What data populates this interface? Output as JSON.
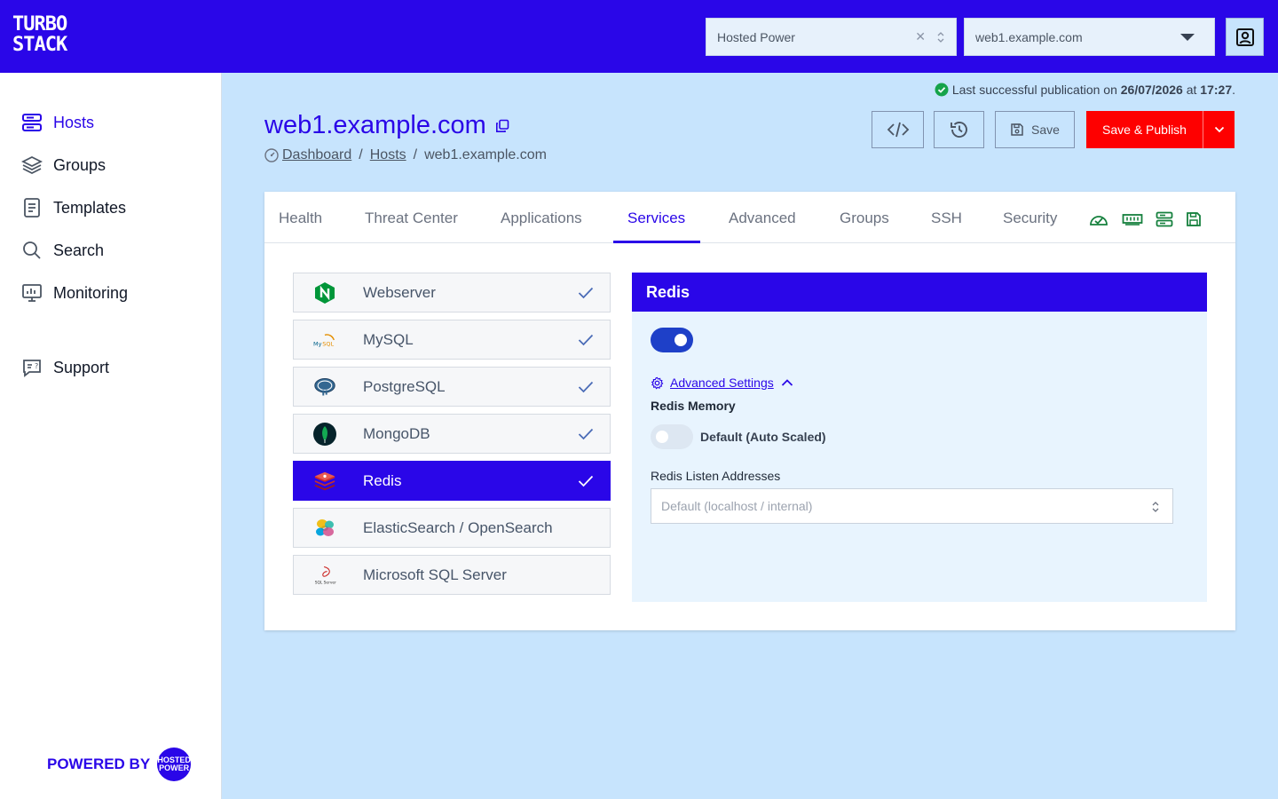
{
  "topbar": {
    "logo_line1": "TURBO",
    "logo_line2": "STACK",
    "owner_select": {
      "value": "Hosted Power"
    },
    "host_select": {
      "value": "web1.example.com"
    }
  },
  "sidebar": {
    "items": [
      {
        "label": "Hosts",
        "icon": "server-icon",
        "active": true
      },
      {
        "label": "Groups",
        "icon": "layers-icon",
        "active": false
      },
      {
        "label": "Templates",
        "icon": "document-icon",
        "active": false
      },
      {
        "label": "Search",
        "icon": "search-icon",
        "active": false
      },
      {
        "label": "Monitoring",
        "icon": "monitor-icon",
        "active": false
      }
    ],
    "support_label": "Support",
    "powered_by": "POWERED BY",
    "powered_badge_1": "HOSTED",
    "powered_badge_2": "POWER"
  },
  "header": {
    "status_prefix": "Last successful publication on ",
    "status_date": "26/07/2026",
    "status_mid": " at ",
    "status_time": "17:27",
    "status_suffix": ".",
    "title": "web1.example.com",
    "breadcrumb": [
      "Dashboard",
      "Hosts",
      "web1.example.com"
    ],
    "save_label": "Save",
    "publish_label": "Save & Publish"
  },
  "tabs": [
    "Health",
    "Threat Center",
    "Applications",
    "Services",
    "Advanced",
    "Groups",
    "SSH",
    "Security"
  ],
  "active_tab": "Services",
  "services": [
    {
      "label": "Webserver",
      "icon": "nginx-icon",
      "enabled": true
    },
    {
      "label": "MySQL",
      "icon": "mysql-icon",
      "enabled": true
    },
    {
      "label": "PostgreSQL",
      "icon": "postgresql-icon",
      "enabled": true
    },
    {
      "label": "MongoDB",
      "icon": "mongodb-icon",
      "enabled": true
    },
    {
      "label": "Redis",
      "icon": "redis-icon",
      "enabled": true
    },
    {
      "label": "ElasticSearch / OpenSearch",
      "icon": "elasticsearch-icon",
      "enabled": false
    },
    {
      "label": "Microsoft SQL Server",
      "icon": "sqlserver-icon",
      "enabled": false
    }
  ],
  "selected_service": "Redis",
  "detail": {
    "title": "Redis",
    "enabled": true,
    "advanced_settings_label": "Advanced Settings",
    "memory_label": "Redis Memory",
    "memory_auto": false,
    "memory_value": "Default (Auto Scaled)",
    "listen_label": "Redis Listen Addresses",
    "listen_placeholder": "Default (localhost / internal)"
  },
  "colors": {
    "brand": "#2a06e8",
    "publish": "#fe0000",
    "background": "#c7e4fd",
    "status_ok": "#16a34a"
  }
}
